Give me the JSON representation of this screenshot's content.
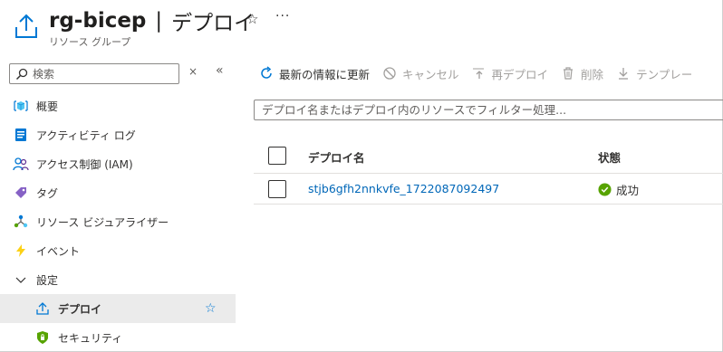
{
  "header": {
    "resource_name": "rg-bicep",
    "separator": "|",
    "page_title": "デプロイ",
    "subtitle": "リソース グループ",
    "favorite_icon": "star-outline-icon",
    "more_label": "···"
  },
  "sidebar": {
    "search": {
      "placeholder": "検索",
      "value": ""
    },
    "collapse_all_label": "×",
    "collapse_sidebar_label": "«",
    "items": [
      {
        "label": "概要",
        "icon": "resource-group-cube-icon"
      },
      {
        "label": "アクティビティ ログ",
        "icon": "activity-log-icon"
      },
      {
        "label": "アクセス制御 (IAM)",
        "icon": "people-icon"
      },
      {
        "label": "タグ",
        "icon": "tag-icon"
      },
      {
        "label": "リソース ビジュアライザー",
        "icon": "visualizer-icon"
      },
      {
        "label": "イベント",
        "icon": "lightning-icon"
      },
      {
        "label": "設定",
        "icon": "chevron-down-icon"
      },
      {
        "label": "デプロイ",
        "icon": "upload-icon",
        "active": true,
        "favorite_label": "☆"
      },
      {
        "label": "セキュリティ",
        "icon": "shield-icon"
      }
    ]
  },
  "toolbar": {
    "refresh": "最新の情報に更新",
    "cancel": "キャンセル",
    "redeploy": "再デプロイ",
    "delete": "削除",
    "template": "テンプレー"
  },
  "filter": {
    "placeholder": "デプロイ名またはデプロイ内のリソースでフィルター処理...",
    "value": ""
  },
  "table": {
    "columns": {
      "name": "デプロイ名",
      "status": "状態"
    },
    "rows": [
      {
        "name": "stjb6gfh2nnkvfe_1722087092497",
        "status": "成功"
      }
    ]
  },
  "colors": {
    "accent": "#0078d4",
    "link": "#0067b8",
    "success": "#57a300",
    "active_bg": "#ebebeb",
    "disabled": "#a19f9d"
  }
}
